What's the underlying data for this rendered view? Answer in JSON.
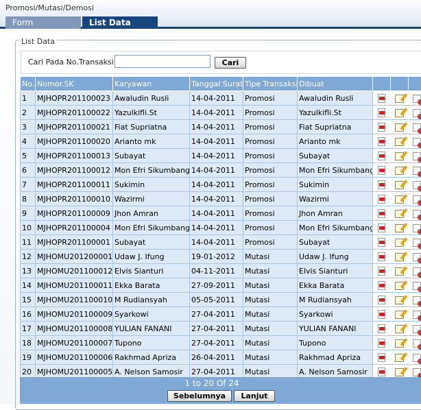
{
  "window": {
    "title": "Promosi/Mutasi/Demosi"
  },
  "tabs": [
    {
      "label": "Form"
    },
    {
      "label": "List Data"
    }
  ],
  "list_section": {
    "legend": "List Data"
  },
  "search": {
    "label": "Cari Pada No.Transaksi",
    "value": "",
    "placeholder": "",
    "button_label": "Cari"
  },
  "table": {
    "headers": [
      "No.",
      "Nomor.SK",
      "Karyawan",
      "Tanggal Surat",
      "Tipe Transaksi",
      "Dibuat"
    ],
    "rows": [
      [
        "1",
        "MJHOPR201100023",
        "Awaludin Rusli",
        "14-04-2011",
        "Promosi",
        "Awaludin Rusli"
      ],
      [
        "2",
        "MJHOPR201100022",
        "Yazulkifli.St",
        "14-04-2011",
        "Promosi",
        "Yazulkifli.St"
      ],
      [
        "3",
        "MJHOPR201100021",
        "Fiat Supriatna",
        "14-04-2011",
        "Promosi",
        "Fiat Supriatna"
      ],
      [
        "4",
        "MJHOPR201100020",
        "Arianto mk",
        "14-04-2011",
        "Promosi",
        "Arianto mk"
      ],
      [
        "5",
        "MJHOPR201100013",
        "Subayat",
        "14-04-2011",
        "Promosi",
        "Subayat"
      ],
      [
        "6",
        "MJHOPR201100012",
        "Mon Efri Sikumbang",
        "14-04-2011",
        "Promosi",
        "Mon Efri Sikumbang"
      ],
      [
        "7",
        "MJHOPR201100011",
        "Sukimin",
        "14-04-2011",
        "Promosi",
        "Sukimin"
      ],
      [
        "8",
        "MJHOPR201100010",
        "Wazirmi",
        "14-04-2011",
        "Promosi",
        "Wazirmi"
      ],
      [
        "9",
        "MJHOPR201100009",
        "Jhon Amran",
        "14-04-2011",
        "Promosi",
        "Jhon Amran"
      ],
      [
        "10",
        "MJHOPR201100004",
        "Mon Efri Sikumbang",
        "14-04-2011",
        "Promosi",
        "Mon Efri Sikumbang"
      ],
      [
        "11",
        "MJHOPR201100001",
        "Subayat",
        "14-04-2011",
        "Promosi",
        "Subayat"
      ],
      [
        "12",
        "MJHOMU201200001",
        "Udaw J. Ifung",
        "19-01-2012",
        "Mutasi",
        "Udaw J. Ifung"
      ],
      [
        "13",
        "MJHOMU201100012",
        "Elvis Sianturi",
        "04-11-2011",
        "Mutasi",
        "Elvis Sianturi"
      ],
      [
        "14",
        "MJHOMU201100011",
        "Ekka Barata",
        "27-09-2011",
        "Mutasi",
        "Ekka Barata"
      ],
      [
        "15",
        "MJHOMU201100010",
        "M Rudiansyah",
        "05-05-2011",
        "Mutasi",
        "M Rudiansyah"
      ],
      [
        "16",
        "MJHOMU201100009",
        "Syarkowi",
        "27-04-2011",
        "Mutasi",
        "Syarkowi"
      ],
      [
        "17",
        "MJHOMU201100008",
        "YULIAN FANANI",
        "27-04-2011",
        "Mutasi",
        "YULIAN FANANI"
      ],
      [
        "18",
        "MJHOMU201100007",
        "Tupono",
        "27-04-2011",
        "Mutasi",
        "Tupono"
      ],
      [
        "19",
        "MJHOMU201100006",
        "Rakhmad Apriza",
        "26-04-2011",
        "Mutasi",
        "Rakhmad Apriza"
      ],
      [
        "20",
        "MJHOMU201100005",
        "A. Nelson Samosir",
        "27-04-2011",
        "Mutasi",
        "A. Nelson Samosir"
      ]
    ],
    "row_actions": [
      "pdf-icon",
      "edit-icon",
      "delete-icon"
    ]
  },
  "pagination": {
    "info": "1 to 20 Of 24",
    "prev_label": "Sebelumnya",
    "next_label": "Lanjut"
  },
  "colors": {
    "header_bg": "#7ea8d6",
    "row_bg": "#ddeaf6",
    "tab_active": "#17467e",
    "tab_inactive": "#8397bb"
  }
}
